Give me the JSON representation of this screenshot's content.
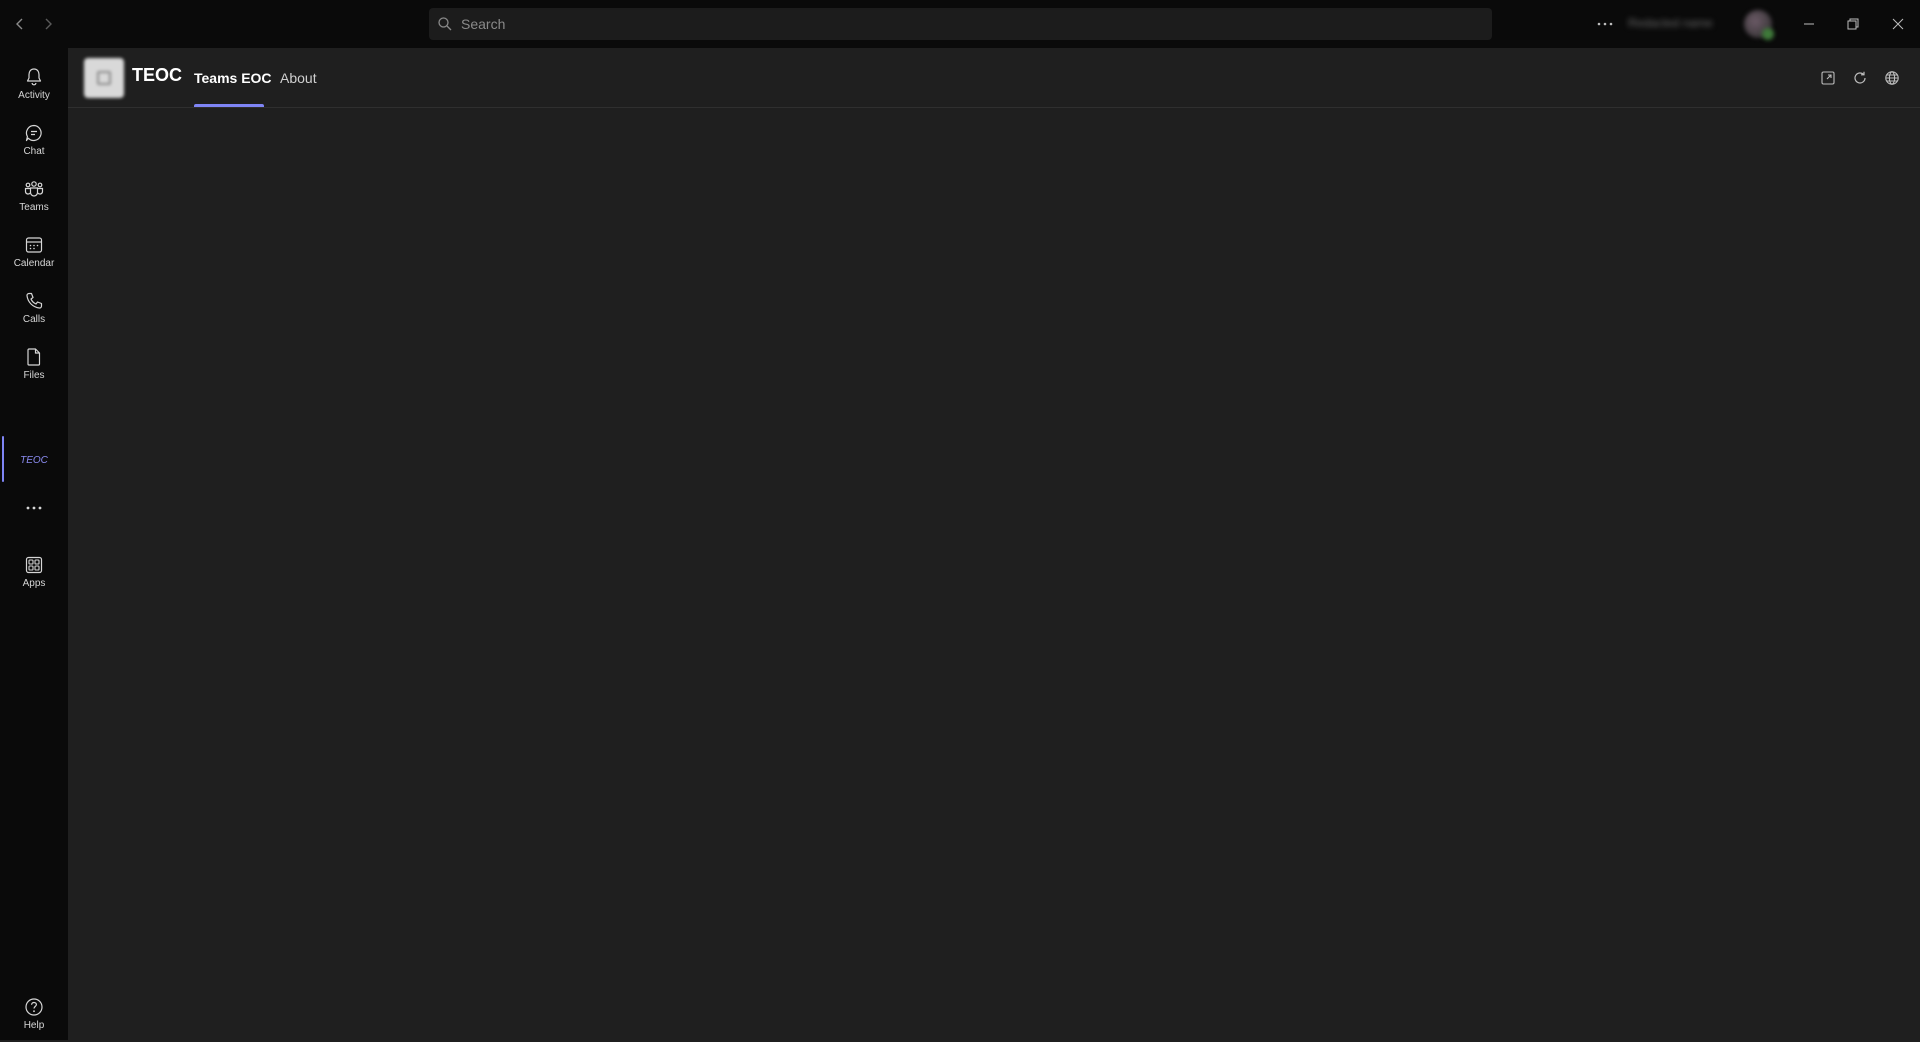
{
  "titlebar": {
    "search_placeholder": "Search",
    "account_name": "Redacted name"
  },
  "rail": {
    "items": [
      {
        "label": "Activity",
        "icon": "bell-icon"
      },
      {
        "label": "Chat",
        "icon": "chat-icon"
      },
      {
        "label": "Teams",
        "icon": "teams-icon"
      },
      {
        "label": "Calendar",
        "icon": "calendar-icon"
      },
      {
        "label": "Calls",
        "icon": "phone-icon"
      },
      {
        "label": "Files",
        "icon": "file-icon"
      },
      {
        "label": "TEOC",
        "icon": "teoc-icon",
        "active": true
      },
      {
        "label": "",
        "icon": "more-icon"
      },
      {
        "label": "Apps",
        "icon": "apps-icon"
      },
      {
        "label": "Help",
        "icon": "help-icon"
      }
    ]
  },
  "app": {
    "title": "TEOC",
    "tabs": [
      {
        "label": "Teams EOC",
        "selected": true
      },
      {
        "label": "About",
        "selected": false
      }
    ]
  },
  "colors": {
    "accent": "#7f85f5",
    "rail_bg": "#0a0a0a",
    "content_bg": "#1f1f1f"
  }
}
